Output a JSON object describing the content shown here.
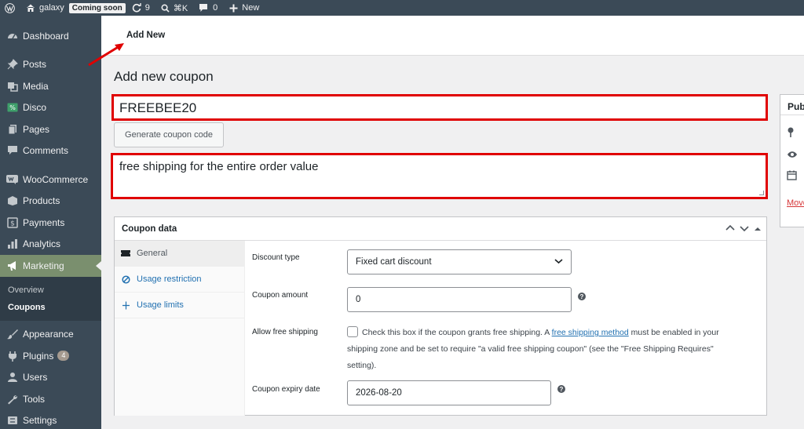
{
  "admin_bar": {
    "site_name": "galaxy",
    "status_badge": "Coming soon",
    "updates_count": "9",
    "shortcut": "⌘K",
    "comments_count": "0",
    "new_label": "New"
  },
  "sidebar": {
    "items": [
      {
        "label": "Dashboard",
        "icon": "dashboard-icon"
      },
      {
        "label": "Posts",
        "icon": "pin-icon"
      },
      {
        "label": "Media",
        "icon": "media-icon"
      },
      {
        "label": "Disco",
        "icon": "disco-icon"
      },
      {
        "label": "Pages",
        "icon": "pages-icon"
      },
      {
        "label": "Comments",
        "icon": "comments-icon"
      },
      {
        "label": "WooCommerce",
        "icon": "woo-icon"
      },
      {
        "label": "Products",
        "icon": "products-icon"
      },
      {
        "label": "Payments",
        "icon": "payments-icon"
      },
      {
        "label": "Analytics",
        "icon": "analytics-icon"
      },
      {
        "label": "Marketing",
        "icon": "megaphone-icon"
      },
      {
        "label": "Appearance",
        "icon": "brush-icon"
      },
      {
        "label": "Plugins",
        "icon": "plugin-icon",
        "badge": "4"
      },
      {
        "label": "Users",
        "icon": "user-icon"
      },
      {
        "label": "Tools",
        "icon": "wrench-icon"
      },
      {
        "label": "Settings",
        "icon": "settings-icon"
      }
    ],
    "submenu": [
      "Overview",
      "Coupons"
    ]
  },
  "header": {
    "tab_label": "Add New"
  },
  "page": {
    "title": "Add new coupon",
    "coupon_code": "FREEBEE20",
    "generate_button": "Generate coupon code",
    "description": "free shipping for the entire order value"
  },
  "publish": {
    "title": "Publish",
    "move_link": "Move to Trash"
  },
  "coupon_data": {
    "heading": "Coupon data",
    "tabs": [
      "General",
      "Usage restriction",
      "Usage limits"
    ],
    "discount_type_label": "Discount type",
    "discount_type_value": "Fixed cart discount",
    "coupon_amount_label": "Coupon amount",
    "coupon_amount_value": "0",
    "free_shipping_label": "Allow free shipping",
    "free_shipping_text_before": "Check this box if the coupon grants free shipping. A ",
    "free_shipping_link": "free shipping method",
    "free_shipping_text_after": " must be enabled in your shipping zone and be set to require \"a valid free shipping coupon\" (see the \"Free Shipping Requires\" setting).",
    "expiry_label": "Coupon expiry date",
    "expiry_value": "2026-08-20"
  },
  "colors": {
    "sidebar_bg": "#3b4a57",
    "active_menu": "#7a8f6e",
    "highlight_border": "#e00000",
    "link": "#2271b1"
  }
}
